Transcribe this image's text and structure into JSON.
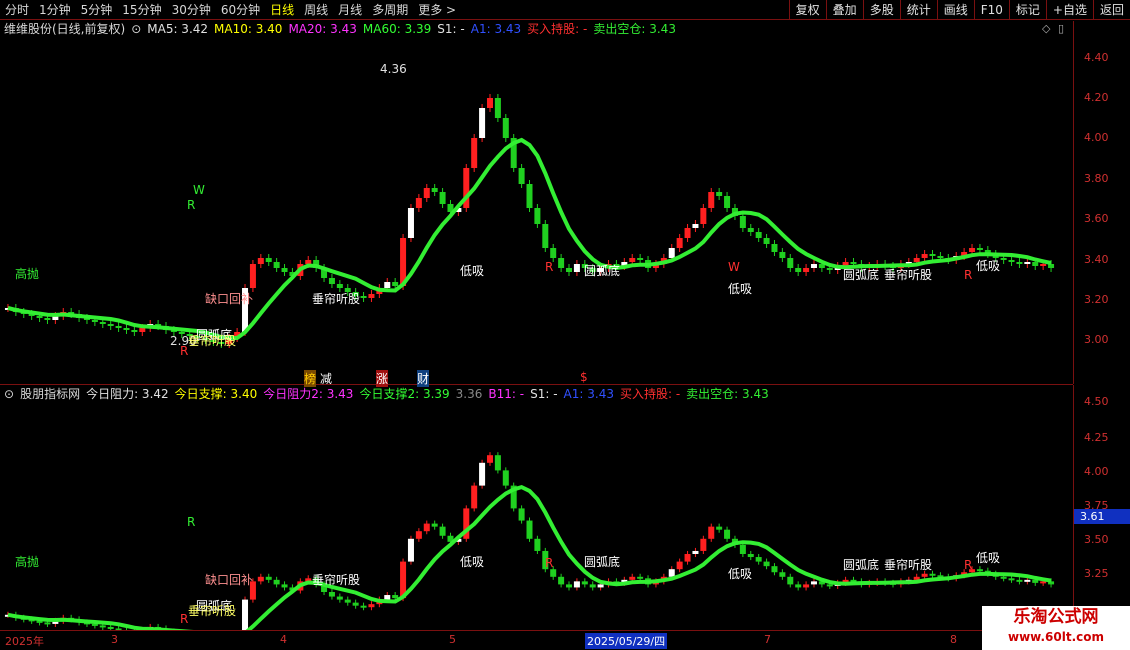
{
  "toolbar": {
    "periods": [
      "分时",
      "1分钟",
      "5分钟",
      "15分钟",
      "30分钟",
      "60分钟",
      "日线",
      "周线",
      "月线",
      "多周期",
      "更多 >"
    ],
    "active": "日线",
    "right_buttons": [
      "复权",
      "叠加",
      "多股",
      "统计",
      "画线",
      "F10",
      "标记",
      "+自选",
      "返回"
    ]
  },
  "top_legend": {
    "title": "维维股份(日线,前复权)",
    "ma5": "MA5: 3.42",
    "ma10": "MA10: 3.40",
    "ma20": "MA20: 3.43",
    "ma60": "MA60: 3.39",
    "s1": "S1: -",
    "a1": "A1: 3.43",
    "buy": "买入持股: -",
    "sell": "卖出空仓: 3.43"
  },
  "bottom_legend": {
    "title": "股朋指标网",
    "r1": "今日阻力: 3.42",
    "s1": "今日支撑: 3.40",
    "r2": "今日阻力2: 3.43",
    "s2": "今日支撑2: 3.39",
    "v336": "3.36",
    "b11": "B11: -",
    "s1b": "S1: -",
    "a1": "A1: 3.43",
    "buy": "买入持股: -",
    "sell": "卖出空仓: 3.43"
  },
  "top_axis": [
    "4.40",
    "4.20",
    "4.00",
    "3.80",
    "3.60",
    "3.40",
    "3.20",
    "3.00"
  ],
  "bottom_axis": [
    "4.50",
    "4.25",
    "4.00",
    "3.75",
    "3.50",
    "3.25"
  ],
  "bottom_axis_highlight": "3.61",
  "dates": [
    "2025年",
    "3",
    "4",
    "5",
    "2025/05/29/四",
    "7",
    "8"
  ],
  "markers": [
    "榜",
    "减",
    "涨",
    "财",
    "$"
  ],
  "annotations": {
    "high_label": "4.36",
    "low_label": "2.90",
    "gaobao": "高抛",
    "quekou": "缺口回补",
    "yuanhudi": "圆弧底",
    "chuilian": "垂帘听股",
    "dixi": "低吸",
    "r": "R",
    "w": "W",
    "kou": "国"
  },
  "watermark": {
    "line1": "乐淘公式网",
    "line2": "www.60lt.com"
  },
  "colors": {
    "up": "#ff2020",
    "down": "#20d020",
    "ma_up": "#ff1a1a",
    "ma_green": "#33ee33",
    "axis": "#d03030"
  }
}
